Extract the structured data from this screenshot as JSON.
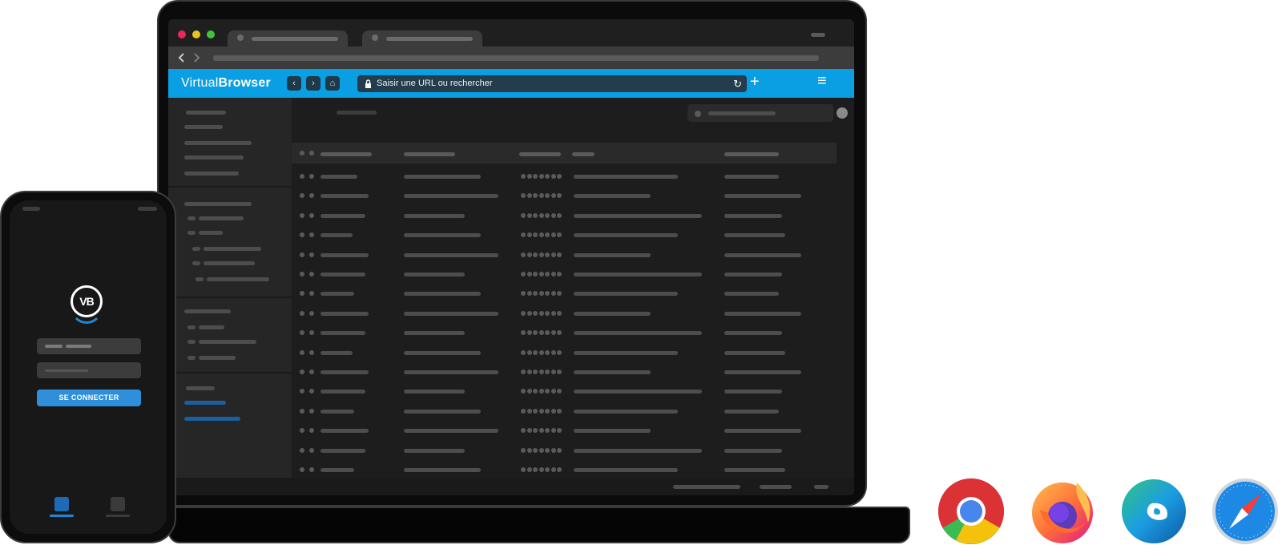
{
  "browser": {
    "app_name_light": "Virtual",
    "app_name_bold": "Browser",
    "address_placeholder": "Saisir une URL ou rechercher",
    "back_glyph": "‹",
    "forward_glyph": "›",
    "home_glyph": "⌂",
    "reload_glyph": "↻",
    "new_tab_glyph": "+",
    "menu_glyph": "≡"
  },
  "mobile": {
    "logo_text": "VB",
    "login_button": "SE CONNECTER"
  },
  "window_dots": [
    "#e8285a",
    "#e9c519",
    "#3fc43c"
  ],
  "browsers": [
    "chrome",
    "firefox",
    "edge",
    "safari"
  ],
  "colors": {
    "header": "#0a9ee3",
    "accent_blue": "#2f8fdb"
  }
}
